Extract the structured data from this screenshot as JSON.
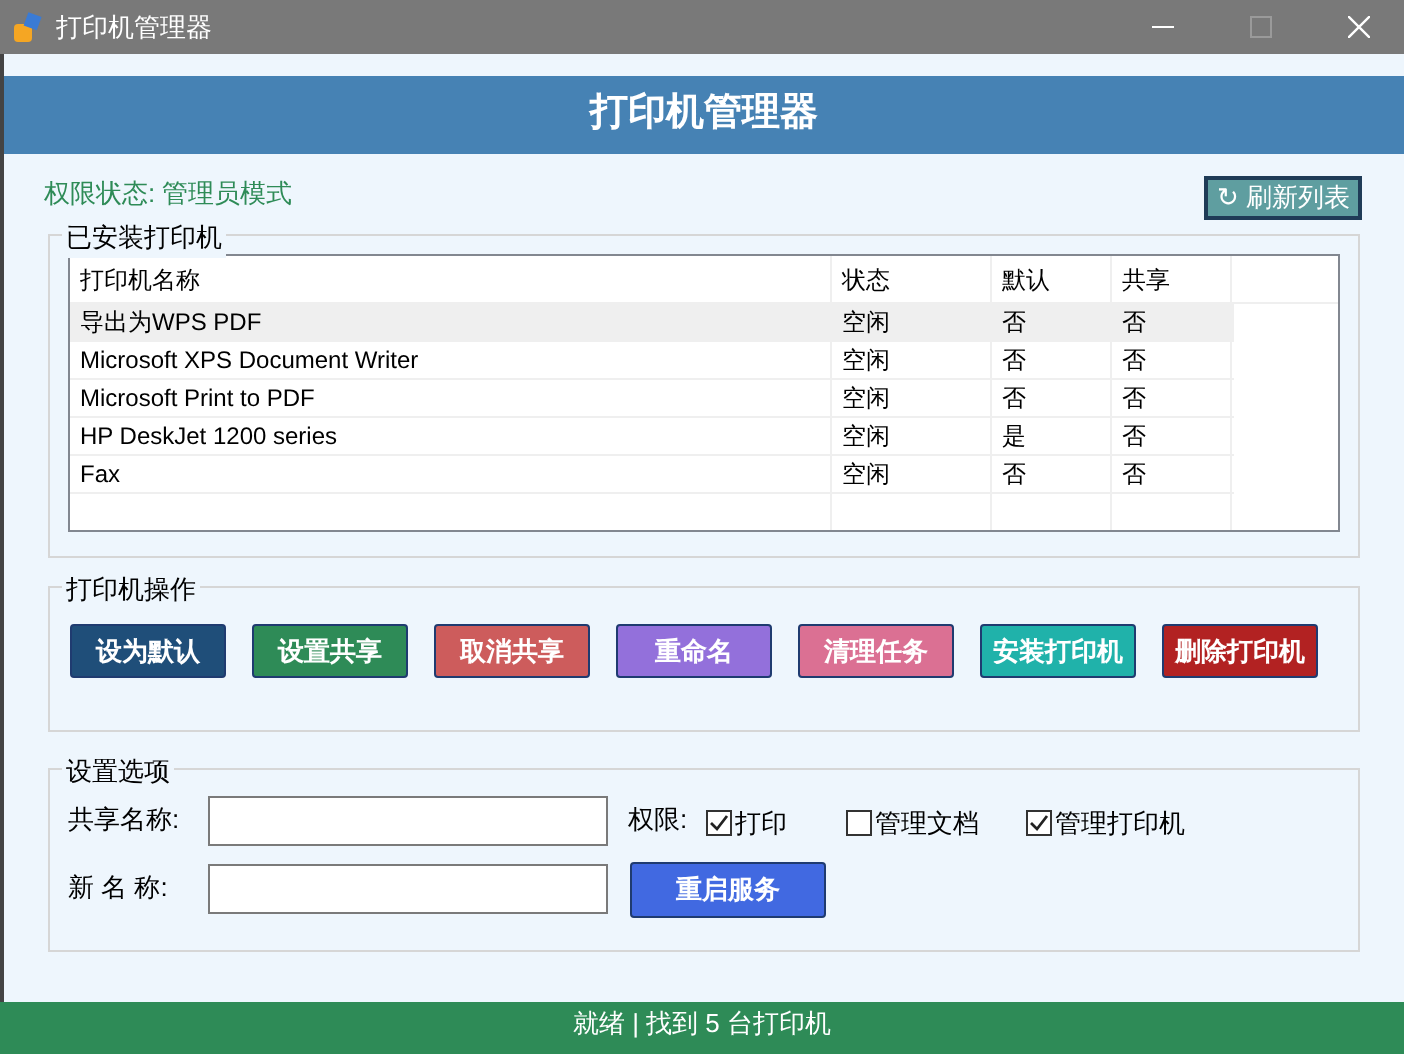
{
  "window": {
    "title": "打印机管理器"
  },
  "header": {
    "title": "打印机管理器"
  },
  "permission_status": "权限状态: 管理员模式",
  "refresh_button": {
    "icon": "↻",
    "label": "刷新列表"
  },
  "installed_group": {
    "title": "已安装打印机",
    "columns": [
      "打印机名称",
      "状态",
      "默认",
      "共享"
    ],
    "rows": [
      {
        "cells": [
          "导出为WPS PDF",
          "空闲",
          "否",
          "否"
        ],
        "selected": true
      },
      {
        "cells": [
          "Microsoft XPS Document Writer",
          "空闲",
          "否",
          "否"
        ],
        "selected": false
      },
      {
        "cells": [
          "Microsoft Print to PDF",
          "空闲",
          "否",
          "否"
        ],
        "selected": false
      },
      {
        "cells": [
          "HP DeskJet 1200 series",
          "空闲",
          "是",
          "否"
        ],
        "selected": false
      },
      {
        "cells": [
          "Fax",
          "空闲",
          "否",
          "否"
        ],
        "selected": false
      }
    ]
  },
  "actions_group": {
    "title": "打印机操作",
    "buttons": [
      {
        "label": "设为默认",
        "color": "#1f4e79"
      },
      {
        "label": "设置共享",
        "color": "#2e8b57"
      },
      {
        "label": "取消共享",
        "color": "#cd5c5c"
      },
      {
        "label": "重命名",
        "color": "#9370db"
      },
      {
        "label": "清理任务",
        "color": "#db7093"
      },
      {
        "label": "安装打印机",
        "color": "#20b2aa"
      },
      {
        "label": "删除打印机",
        "color": "#b22222"
      }
    ]
  },
  "settings_group": {
    "title": "设置选项",
    "share_name_label": "共享名称:",
    "new_name_label": "新 名 称:",
    "permissions_label": "权限:",
    "permissions": [
      {
        "label": "打印",
        "checked": true
      },
      {
        "label": "管理文档",
        "checked": false
      },
      {
        "label": "管理打印机",
        "checked": true
      }
    ],
    "restart_button": "重启服务"
  },
  "status_bar": "就绪 | 找到 5 台打印机"
}
